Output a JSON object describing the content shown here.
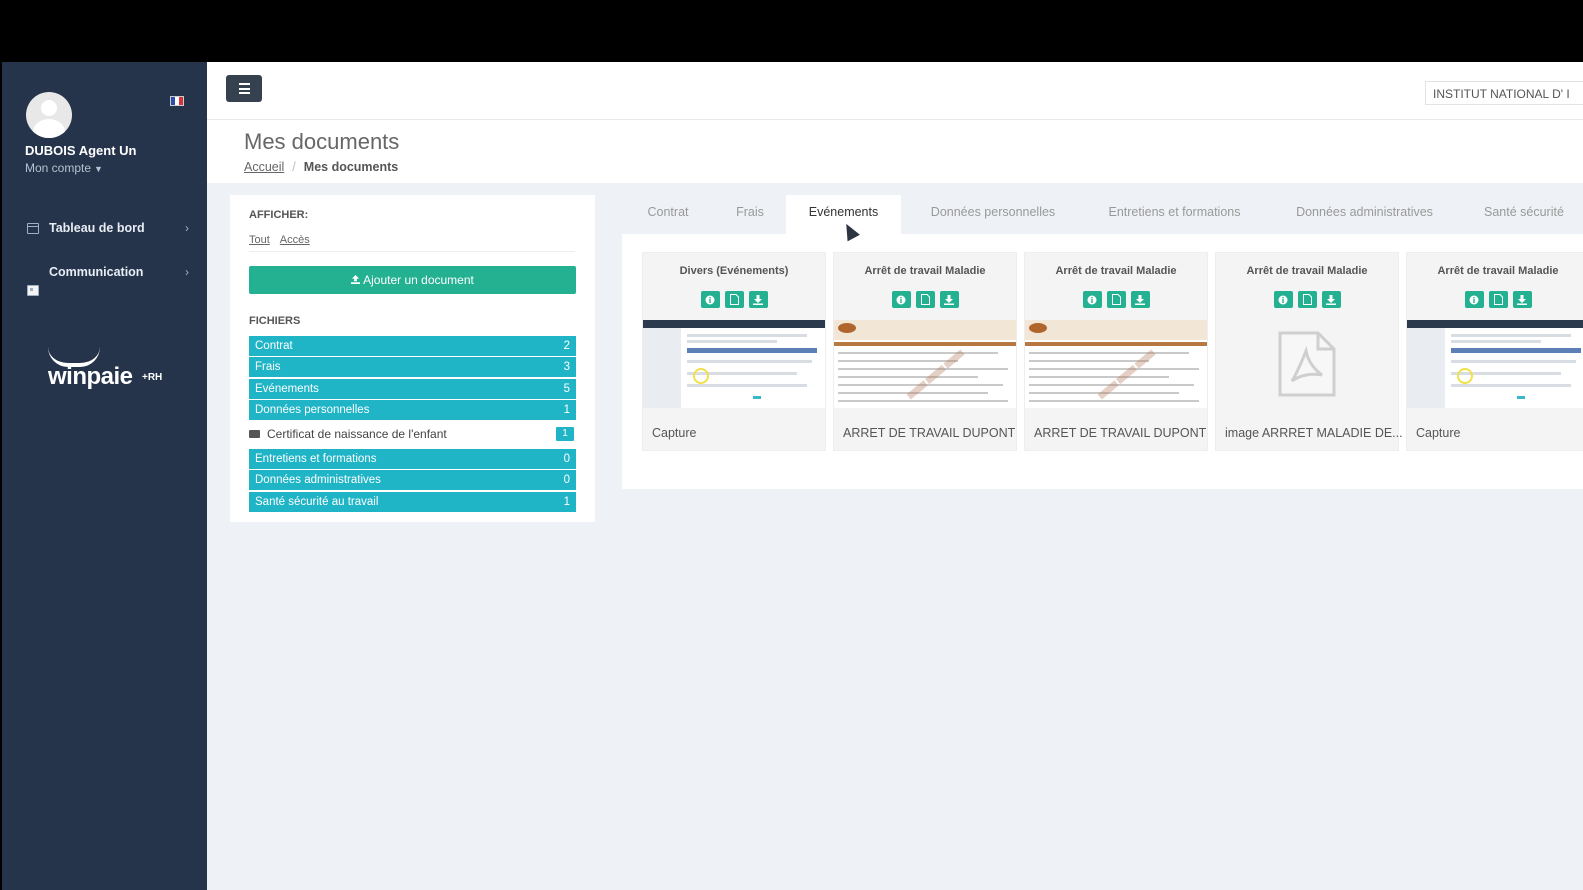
{
  "sidebar": {
    "user_name": "DUBOIS Agent Un",
    "account_label": "Mon compte",
    "nav": [
      {
        "label": "Tableau de bord",
        "icon": "calendar-icon"
      },
      {
        "label": "Communication",
        "icon": "id-card-icon"
      }
    ],
    "logo_text": "winpaie",
    "logo_suffix": "+RH",
    "flag_colors": [
      "#2b4fa8",
      "#ffffff",
      "#d8333a"
    ]
  },
  "header": {
    "organization": "INSTITUT NATIONAL D' I"
  },
  "page": {
    "title": "Mes documents",
    "breadcrumb": [
      {
        "label": "Accueil"
      },
      {
        "label": "Mes documents"
      }
    ]
  },
  "left_panel": {
    "show_label": "AFFICHER:",
    "filters": [
      "Tout",
      "Accès"
    ],
    "add_button": "Ajouter un document",
    "files_label": "FICHIERS",
    "categories": [
      {
        "label": "Contrat",
        "count": "2"
      },
      {
        "label": "Frais",
        "count": "3"
      },
      {
        "label": "Evénements",
        "count": "5"
      },
      {
        "label": "Données personnelles",
        "count": "1"
      },
      {
        "label": "Entretiens et formations",
        "count": "0"
      },
      {
        "label": "Données administratives",
        "count": "0"
      },
      {
        "label": "Santé sécurité au travail",
        "count": "1"
      }
    ],
    "subcategory": {
      "label": "Certificat de naissance de l'enfant",
      "count": "1"
    }
  },
  "tabs": [
    {
      "label": "Contrat",
      "active": false
    },
    {
      "label": "Frais",
      "active": false
    },
    {
      "label": "Evénements",
      "active": true
    },
    {
      "label": "Données personnelles",
      "active": false
    },
    {
      "label": "Entretiens et formations",
      "active": false
    },
    {
      "label": "Données administratives",
      "active": false
    },
    {
      "label": "Santé sécurité",
      "active": false
    }
  ],
  "documents": [
    {
      "category": "Divers (Evénements)",
      "caption": "Capture",
      "thumbnail": "screenshot"
    },
    {
      "category": "Arrêt de travail Maladie",
      "caption": "ARRET DE TRAVAIL DUPONT",
      "thumbnail": "form"
    },
    {
      "category": "Arrêt de travail Maladie",
      "caption": "ARRET DE TRAVAIL DUPONT",
      "thumbnail": "form"
    },
    {
      "category": "Arrêt de travail Maladie",
      "caption": "image ARRRET MALADIE DE...",
      "thumbnail": "pdf-icon"
    },
    {
      "category": "Arrêt de travail Maladie",
      "caption": "Capture",
      "thumbnail": "screenshot"
    }
  ],
  "colors": {
    "sidebar": "#26344b",
    "accent_green": "#23b192",
    "accent_cyan": "#1fb5c7"
  }
}
